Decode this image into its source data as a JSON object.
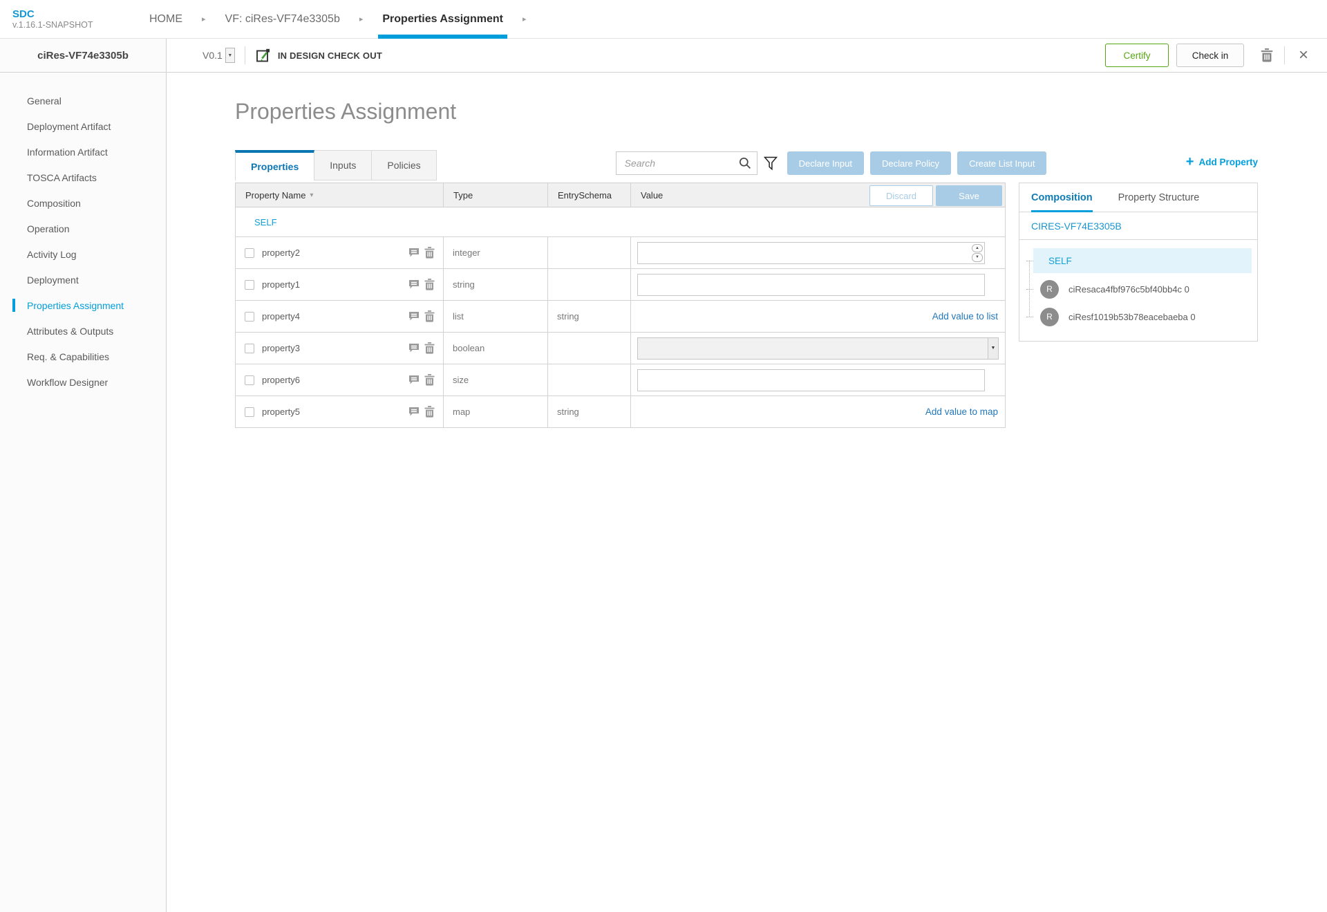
{
  "app": {
    "logo": "SDC",
    "version": "v.1.16.1-SNAPSHOT"
  },
  "breadcrumbs": [
    {
      "label": "HOME",
      "active": false
    },
    {
      "label": "VF: ciRes-VF74e3305b",
      "active": false
    },
    {
      "label": "Properties Assignment",
      "active": true
    }
  ],
  "toolbar": {
    "entity_name": "ciRes-VF74e3305b",
    "version": "V0.1",
    "status": "IN DESIGN CHECK OUT",
    "certify_label": "Certify",
    "checkin_label": "Check in"
  },
  "sidebar": {
    "items": [
      {
        "label": "General",
        "active": false
      },
      {
        "label": "Deployment Artifact",
        "active": false
      },
      {
        "label": "Information Artifact",
        "active": false
      },
      {
        "label": "TOSCA Artifacts",
        "active": false
      },
      {
        "label": "Composition",
        "active": false
      },
      {
        "label": "Operation",
        "active": false
      },
      {
        "label": "Activity Log",
        "active": false
      },
      {
        "label": "Deployment",
        "active": false
      },
      {
        "label": "Properties Assignment",
        "active": true
      },
      {
        "label": "Attributes & Outputs",
        "active": false
      },
      {
        "label": "Req. & Capabilities",
        "active": false
      },
      {
        "label": "Workflow Designer",
        "active": false
      }
    ]
  },
  "main": {
    "title": "Properties Assignment",
    "tabs": [
      {
        "label": "Properties",
        "active": true
      },
      {
        "label": "Inputs",
        "active": false
      },
      {
        "label": "Policies",
        "active": false
      }
    ],
    "search": {
      "placeholder": "Search",
      "value": ""
    },
    "actions": [
      {
        "label": "Declare Input"
      },
      {
        "label": "Declare Policy"
      },
      {
        "label": "Create List Input"
      }
    ],
    "add_property_label": "Add Property",
    "table": {
      "headers": {
        "name": "Property Name",
        "type": "Type",
        "entry_schema": "EntrySchema",
        "value": "Value"
      },
      "discard_label": "Discard",
      "save_label": "Save",
      "group_label": "SELF",
      "rows": [
        {
          "name": "property2",
          "type": "integer",
          "entry_schema": "",
          "value": "",
          "value_kind": "number"
        },
        {
          "name": "property1",
          "type": "string",
          "entry_schema": "",
          "value": "",
          "value_kind": "text"
        },
        {
          "name": "property4",
          "type": "list",
          "entry_schema": "string",
          "value_kind": "link",
          "link_label": "Add value to list"
        },
        {
          "name": "property3",
          "type": "boolean",
          "entry_schema": "",
          "value": "",
          "value_kind": "select"
        },
        {
          "name": "property6",
          "type": "size",
          "entry_schema": "",
          "value": "",
          "value_kind": "text"
        },
        {
          "name": "property5",
          "type": "map",
          "entry_schema": "string",
          "value_kind": "link",
          "link_label": "Add value to map"
        }
      ]
    }
  },
  "right_panel": {
    "tabs": [
      {
        "label": "Composition",
        "active": true
      },
      {
        "label": "Property Structure",
        "active": false
      }
    ],
    "component_title": "CIRES-VF74E3305B",
    "tree": {
      "root_label": "SELF",
      "children": [
        {
          "avatar": "R",
          "label": "ciResaca4fbf976c5bf40bb4c 0"
        },
        {
          "avatar": "R",
          "label": "ciResf1019b53b78eacebaeba 0"
        }
      ]
    }
  },
  "icons": {
    "search": "magnifier",
    "filter": "funnel",
    "comment": "speech-bubble",
    "delete": "trash-can",
    "checkout": "edit-square",
    "close": "×",
    "add": "+",
    "breadcrumb_caret": "▸",
    "sort_caret": "▾"
  },
  "colors": {
    "accent_blue": "#009fdb",
    "tab_blue": "#0c76b2",
    "button_blue": "#a9cce6",
    "link_blue": "#2277bb",
    "certify_green": "#55a512",
    "sidebar_bg": "#fbfbfb",
    "border": "#d2d2d2",
    "tree_highlight": "#e3f3fb"
  }
}
